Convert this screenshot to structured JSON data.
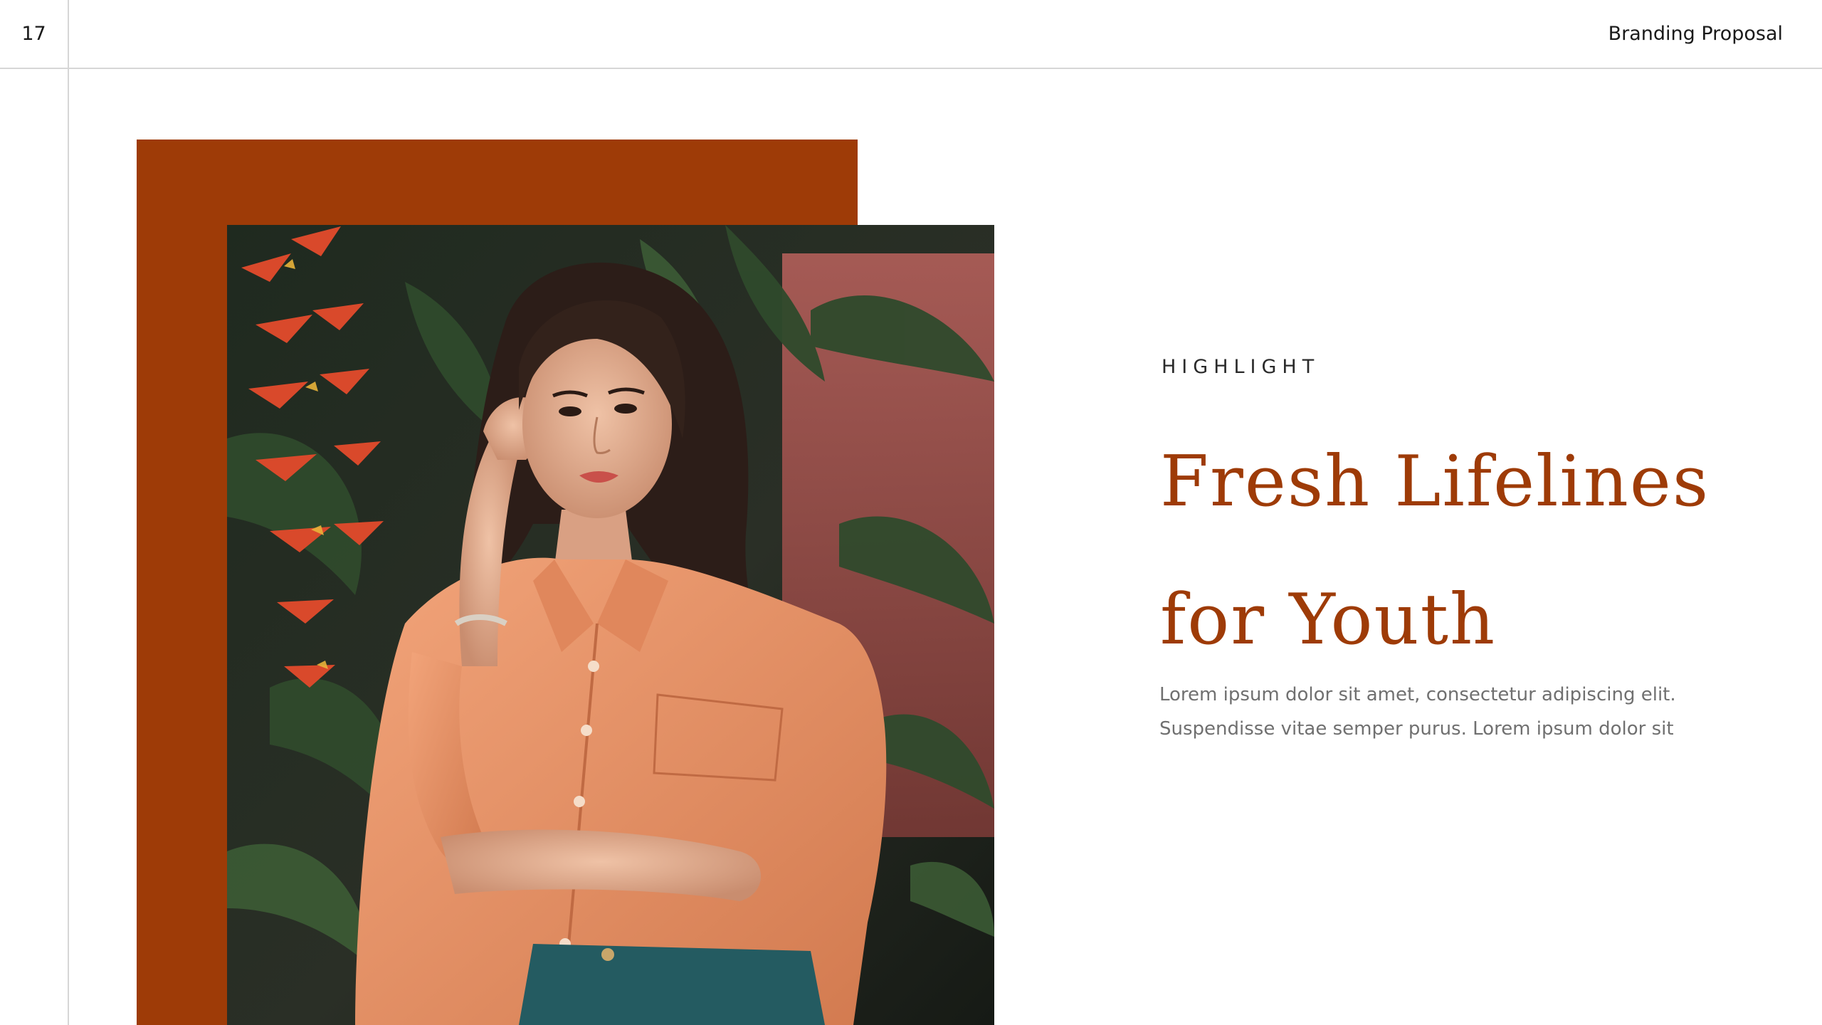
{
  "header": {
    "page_number": "17",
    "deck_title": "Branding Proposal"
  },
  "colors": {
    "accent": "#9e3b07",
    "text_dark": "#1a1a1a",
    "body_grey": "#707070",
    "rule_grey": "#d6d6d6"
  },
  "hero": {
    "eyebrow": "HIGHLIGHT",
    "headline_line1": "Fresh Lifelines",
    "headline_line2": "for Youth",
    "body_line1": "Lorem ipsum dolor sit amet, consectetur adipiscing elit.",
    "body_line2": "Suspendisse vitae semper purus. Lorem ipsum dolor sit"
  }
}
